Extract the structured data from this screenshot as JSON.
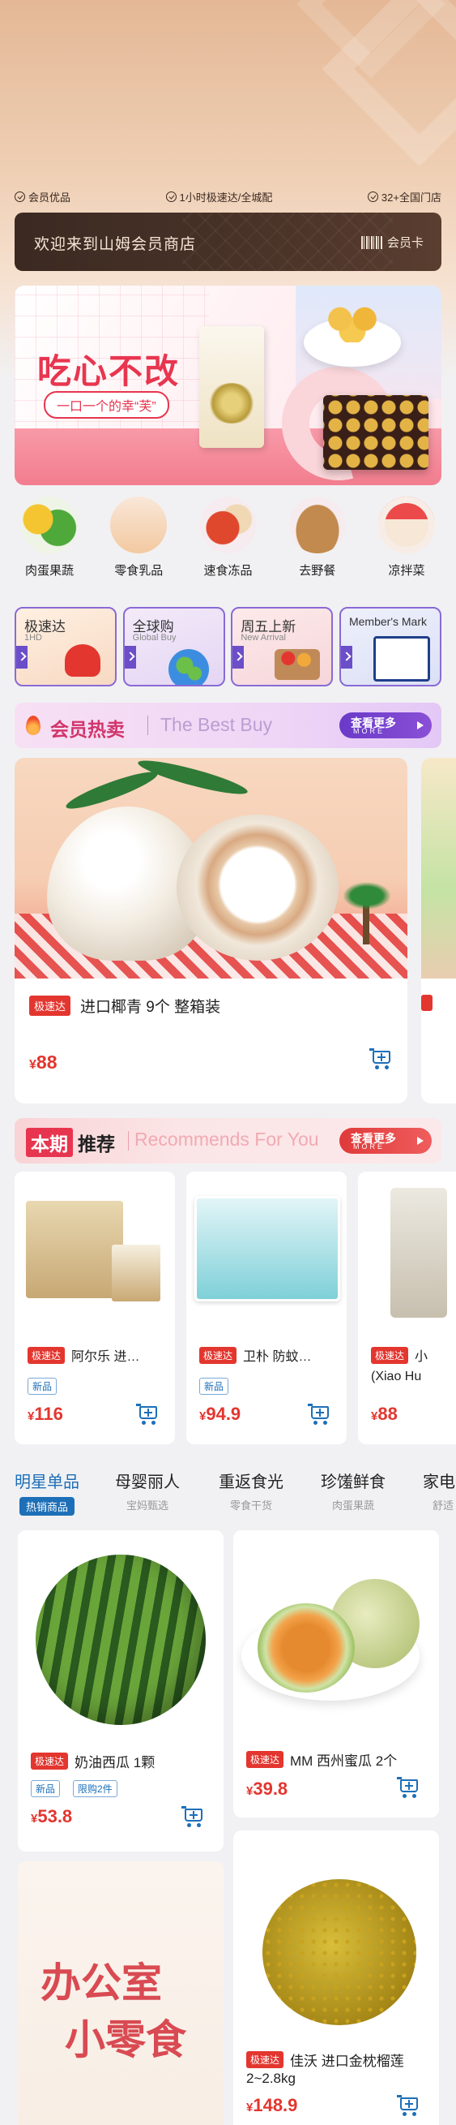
{
  "perks": [
    "会员优品",
    "1小时极速达/全城配",
    "32+全国门店"
  ],
  "welcome": {
    "text": "欢迎来到山姆会员商店",
    "card_label": "会员卡"
  },
  "banner": {
    "title": "吃心不改",
    "subtitle": "一口一个的幸“芙”"
  },
  "categories": [
    "肉蛋果蔬",
    "零食乳品",
    "速食冻品",
    "去野餐",
    "凉拌菜"
  ],
  "shortcuts": [
    {
      "title": "极速达",
      "sub": "1HD"
    },
    {
      "title": "全球购",
      "sub": "Global Buy"
    },
    {
      "title": "周五上新",
      "sub": "New Arrival"
    },
    {
      "title": "Member's Mark",
      "sub": ""
    }
  ],
  "hot_sale": {
    "title": "会员热卖",
    "en": "The Best Buy",
    "more": "查看更多",
    "more_en": "MORE",
    "product": {
      "tag": "极速达",
      "name": "进口椰青 9个 整箱装",
      "currency": "¥",
      "price": "88"
    }
  },
  "recommend": {
    "b1": "本期",
    "b2": "推荐",
    "en": "Recommends For You",
    "more": "查看更多",
    "more_en": "MORE",
    "items": [
      {
        "tag": "极速达",
        "name": "阿尔乐 进…",
        "badge": "新品",
        "currency": "¥",
        "price": "116"
      },
      {
        "tag": "极速达",
        "name": "卫朴 防蚊…",
        "badge": "新品",
        "currency": "¥",
        "price": "94.9"
      },
      {
        "tag": "极速达",
        "name": "小",
        "name2": "(Xiao Hu",
        "currency": "¥",
        "price": "88"
      }
    ]
  },
  "tabs": [
    {
      "title": "明星单品",
      "sub": "热销商品"
    },
    {
      "title": "母婴丽人",
      "sub": "宝妈甄选"
    },
    {
      "title": "重返食光",
      "sub": "零食干货"
    },
    {
      "title": "珍馐鲜食",
      "sub": "肉蛋果蔬"
    },
    {
      "title": "家电",
      "sub": "舒适"
    }
  ],
  "grid": {
    "p1": {
      "tag": "极速达",
      "name": "奶油西瓜 1颗",
      "badge1": "新品",
      "badge2": "限购2件",
      "currency": "¥",
      "price": "53.8"
    },
    "p2": {
      "tag": "极速达",
      "name": "MM 西州蜜瓜 2个",
      "currency": "¥",
      "price": "39.8"
    },
    "p3": {
      "title1": "办公室",
      "title2": "小零食"
    },
    "p4": {
      "tag": "极速达",
      "name": "佳沃 进口金枕榴莲",
      "name2": "2~2.8kg",
      "currency": "¥",
      "price": "148.9"
    }
  },
  "colors": {
    "accent": "#e3362f",
    "brand_blue": "#1d6fb8",
    "header_dark": "#3b2a22"
  }
}
